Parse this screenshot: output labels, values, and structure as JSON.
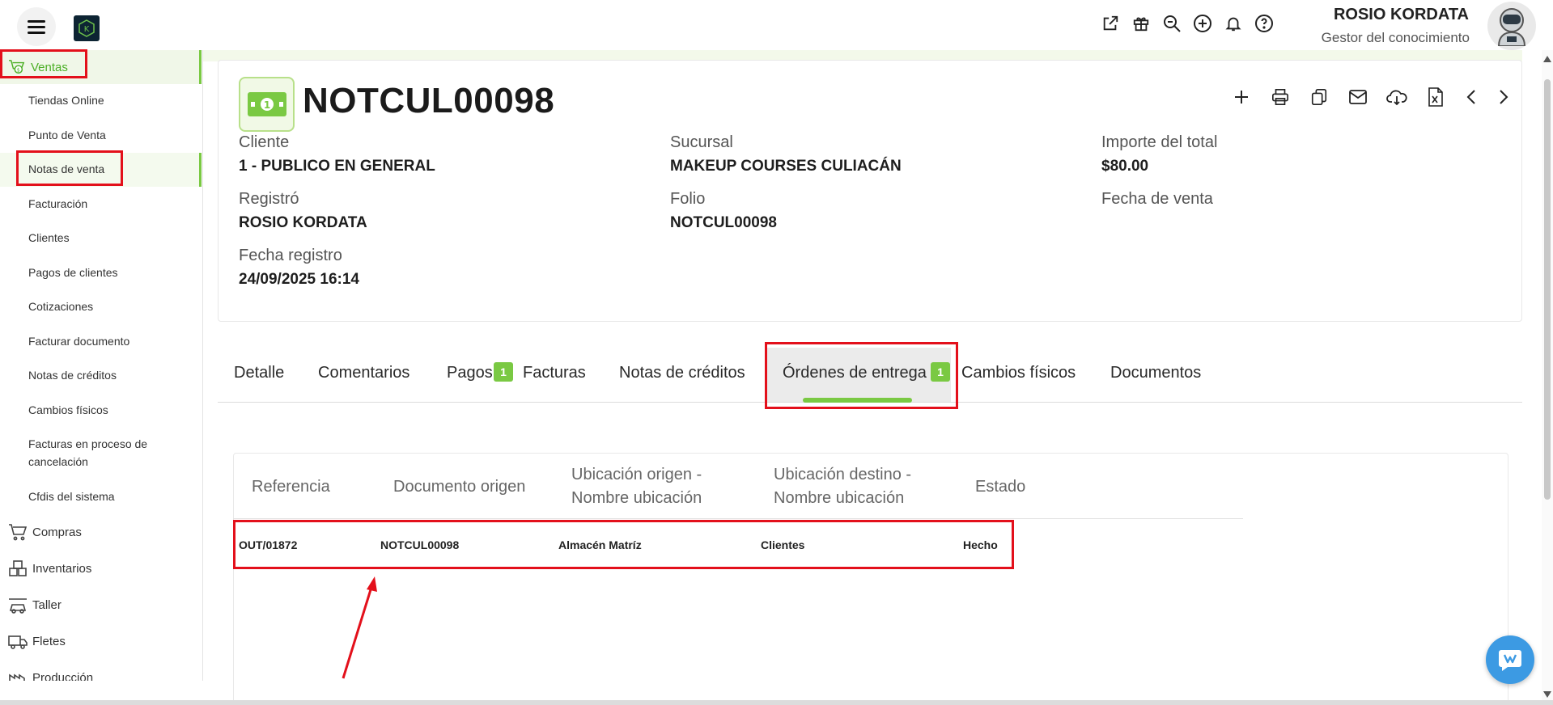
{
  "header": {
    "user_name": "ROSIO KORDATA",
    "user_role": "Gestor del conocimiento",
    "icons": [
      "external-link-icon",
      "gift-icon",
      "search-zoom-icon",
      "plus-circle-icon",
      "bell-icon",
      "help-icon"
    ]
  },
  "sidebar": {
    "section": "Ventas",
    "items": [
      "Tiendas Online",
      "Punto de Venta",
      "Notas de venta",
      "Facturación",
      "Clientes",
      "Pagos de clientes",
      "Cotizaciones",
      "Facturar documento",
      "Notas de créditos",
      "Cambios físicos",
      "Facturas en proceso de cancelación",
      "Cfdis del sistema"
    ],
    "groups": [
      "Compras",
      "Inventarios",
      "Taller",
      "Fletes",
      "Producción"
    ]
  },
  "document": {
    "title": "NOTCUL00098",
    "fields": {
      "cliente_label": "Cliente",
      "cliente_value": "1 - PUBLICO EN GENERAL",
      "sucursal_label": "Sucursal",
      "sucursal_value": "MAKEUP COURSES CULIACÁN",
      "importe_label": "Importe del total",
      "importe_value": "$80.00",
      "registro_label": "Registró",
      "registro_value": "ROSIO KORDATA",
      "folio_label": "Folio",
      "folio_value": "NOTCUL00098",
      "fecha_venta_label": "Fecha de venta",
      "fecha_registro_label": "Fecha registro",
      "fecha_registro_value": "24/09/2025 16:14"
    }
  },
  "tabs": {
    "detalle": "Detalle",
    "comentarios": "Comentarios",
    "pagos": "Pagos",
    "pagos_badge": "1",
    "facturas": "Facturas",
    "notas_creditos": "Notas de créditos",
    "ordenes": "Órdenes de entrega",
    "ordenes_badge": "1",
    "cambios": "Cambios físicos",
    "documentos": "Documentos"
  },
  "table": {
    "headers": {
      "referencia": "Referencia",
      "documento_origen": "Documento origen",
      "ubicacion_origen_1": "Ubicación origen -",
      "ubicacion_origen_2": "Nombre ubicación",
      "ubicacion_destino_1": "Ubicación destino -",
      "ubicacion_destino_2": "Nombre ubicación",
      "estado": "Estado"
    },
    "rows": [
      {
        "referencia": "OUT/01872",
        "documento_origen": "NOTCUL00098",
        "ubicacion_origen": "Almacén Matríz",
        "ubicacion_destino": "Clientes",
        "estado": "Hecho"
      }
    ]
  },
  "colors": {
    "accent": "#7ac943",
    "highlight": "#e3101b",
    "chat": "#3c9ae3"
  }
}
